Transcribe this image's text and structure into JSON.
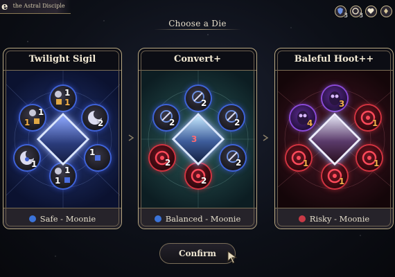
{
  "header": {
    "name_fragment": "e",
    "subtitle": "the Astral Disciple",
    "status_icons": [
      {
        "icon": "shield-icon",
        "count": "3"
      },
      {
        "icon": "swirl-icon",
        "count": "3"
      },
      {
        "icon": "heart-icon",
        "count": ""
      },
      {
        "icon": "gem-icon",
        "count": ""
      }
    ]
  },
  "heading": "Choose a Die",
  "cards": [
    {
      "title": "Twilight Sigil",
      "theme": "blue",
      "footer": "Safe - Moonie",
      "footer_color": "#3b73d8",
      "faces": [
        {
          "label": "1",
          "sub": "1"
        },
        {
          "label": "1",
          "sub": "1"
        },
        {
          "label": "2",
          "sub": ""
        },
        {
          "label": "1",
          "sub": ""
        },
        {
          "label": "1",
          "sub": ""
        },
        {
          "label": "1",
          "sub": "1"
        }
      ]
    },
    {
      "title": "Convert+",
      "theme": "teal",
      "footer": "Balanced - Moonie",
      "footer_color": "#3b73d8",
      "faces": [
        {
          "label": "2"
        },
        {
          "label": "2"
        },
        {
          "label": "2"
        },
        {
          "label": "2"
        },
        {
          "label": "2"
        },
        {
          "label": "3"
        }
      ]
    },
    {
      "title": "Baleful Hoot++",
      "theme": "red",
      "footer": "Risky - Moonie",
      "footer_color": "#c83a46",
      "faces": [
        {
          "label": "3"
        },
        {
          "label": "4"
        },
        {
          "label": "1"
        },
        {
          "label": "1"
        },
        {
          "label": "1"
        },
        {
          "label": "1"
        }
      ]
    }
  ],
  "confirm_label": "Confirm"
}
